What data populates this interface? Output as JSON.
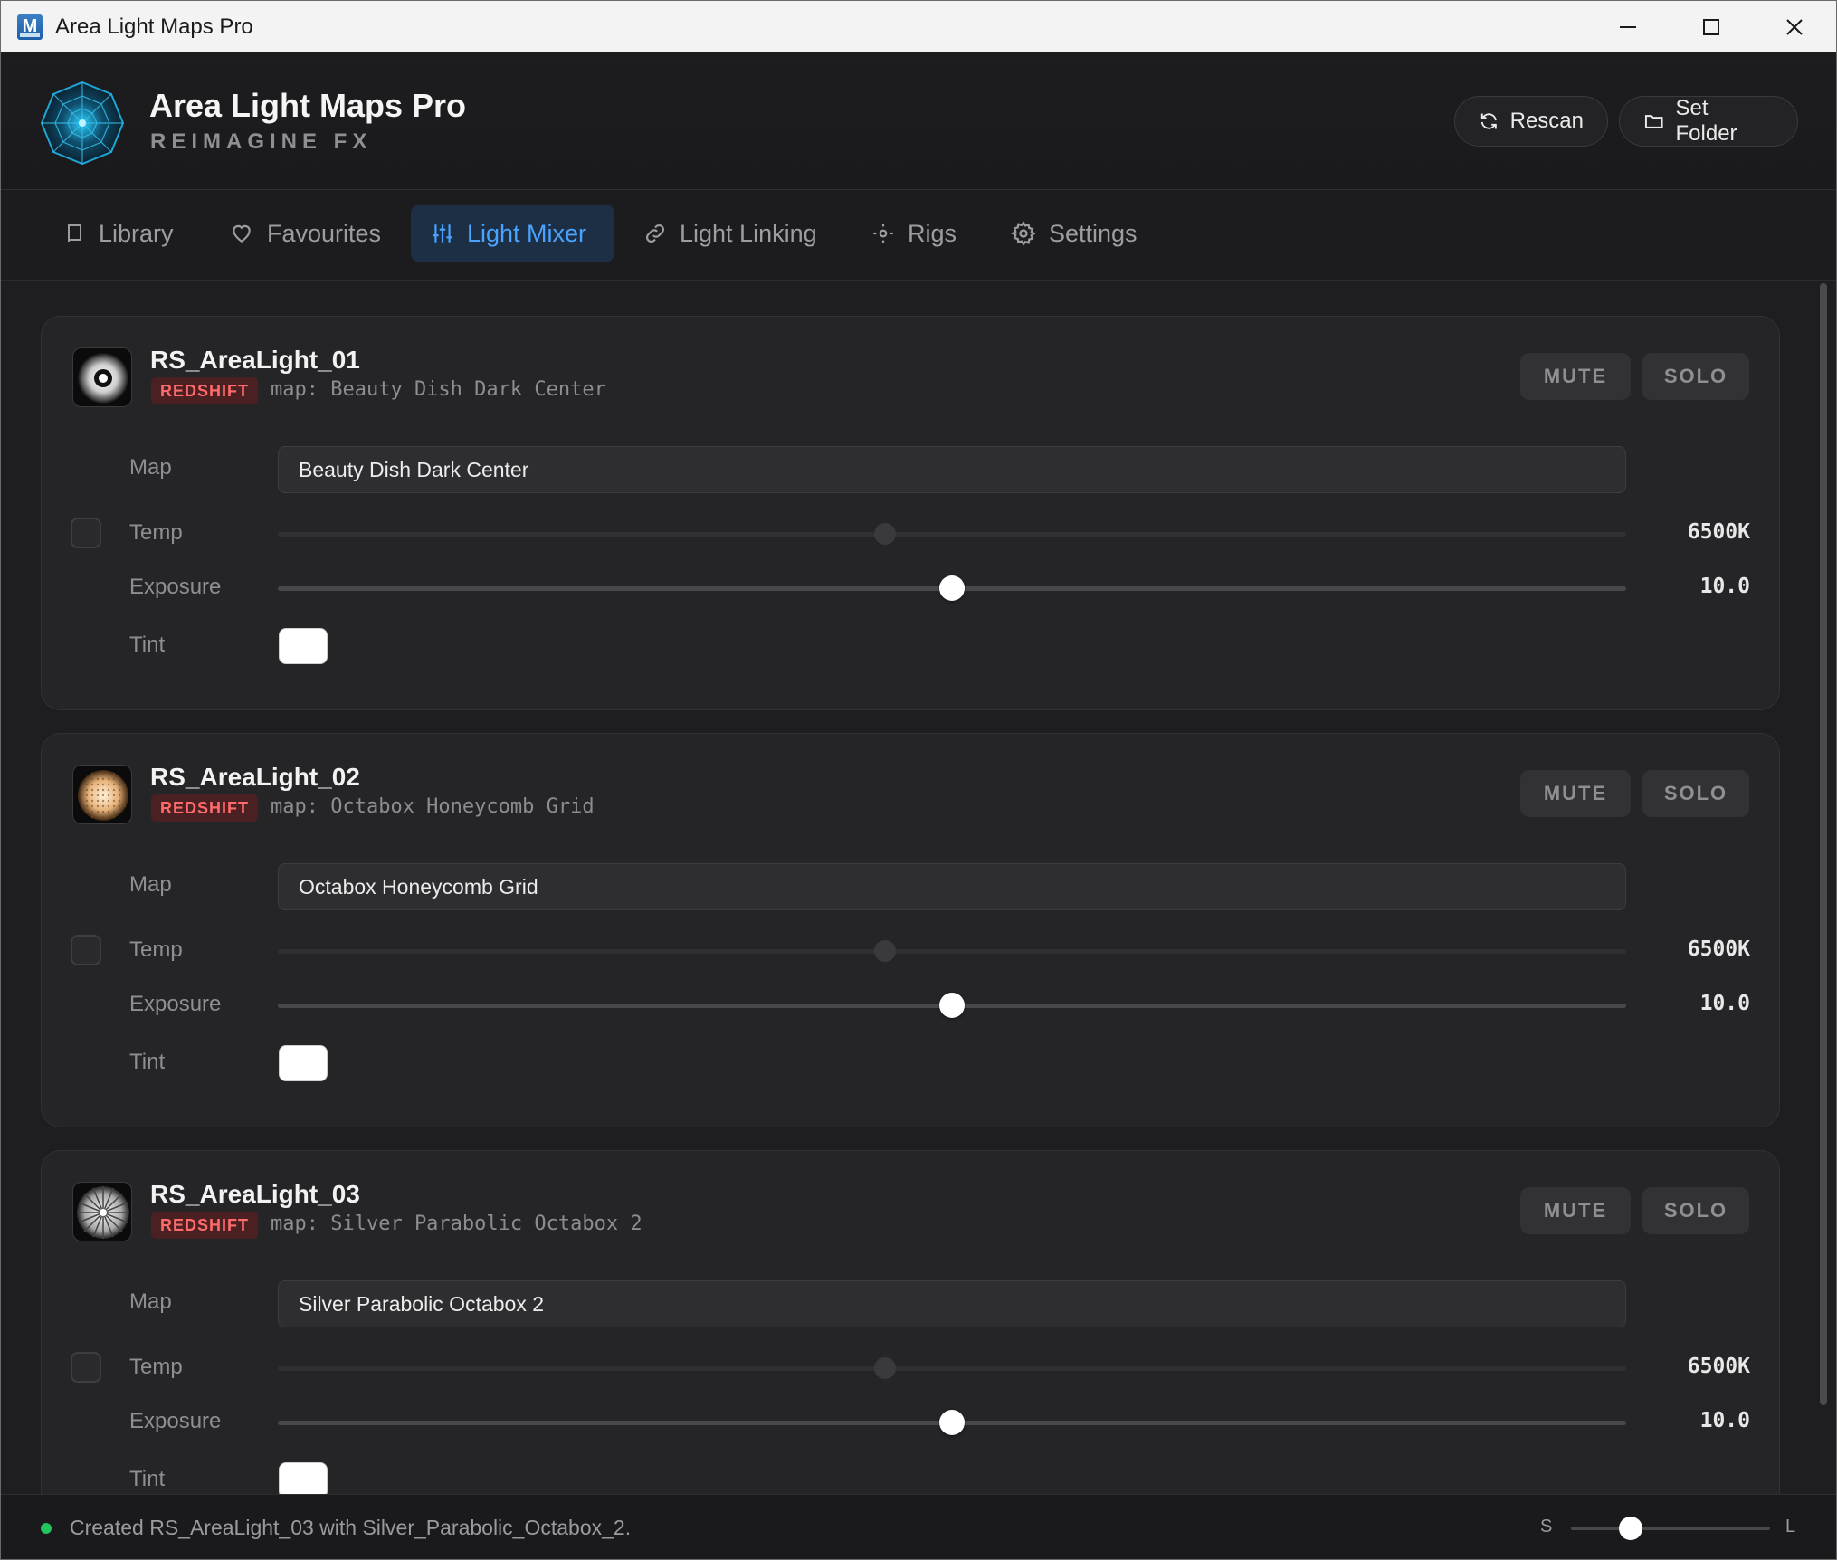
{
  "window": {
    "title": "Area Light Maps Pro",
    "icon_letter": "M"
  },
  "header": {
    "title": "Area Light Maps Pro",
    "subtitle": "REIMAGINE FX",
    "rescan_label": "Rescan",
    "set_folder_label": "Set Folder"
  },
  "tabs": [
    {
      "label": "Library",
      "icon": "book-icon",
      "active": false
    },
    {
      "label": "Favourites",
      "icon": "heart-icon",
      "active": false
    },
    {
      "label": "Light Mixer",
      "icon": "sliders-icon",
      "active": true
    },
    {
      "label": "Light Linking",
      "icon": "link-icon",
      "active": false
    },
    {
      "label": "Rigs",
      "icon": "sun-icon",
      "active": false
    },
    {
      "label": "Settings",
      "icon": "gear-icon",
      "active": false
    }
  ],
  "lights": [
    {
      "name": "RS_AreaLight_01",
      "renderer": "REDSHIFT",
      "map_line": "map: Beauty Dish Dark Center",
      "map": "Beauty Dish Dark Center",
      "mute_label": "MUTE",
      "solo_label": "SOLO",
      "labels": {
        "map": "Map",
        "temp": "Temp",
        "exposure": "Exposure",
        "tint": "Tint"
      },
      "temp_value": "6500K",
      "temp_fraction": 0.45,
      "exposure_value": "10.0",
      "exposure_fraction": 0.5,
      "tint_color": "#ffffff",
      "thumb": "beauty-dish"
    },
    {
      "name": "RS_AreaLight_02",
      "renderer": "REDSHIFT",
      "map_line": "map: Octabox Honeycomb Grid",
      "map": "Octabox Honeycomb Grid",
      "mute_label": "MUTE",
      "solo_label": "SOLO",
      "labels": {
        "map": "Map",
        "temp": "Temp",
        "exposure": "Exposure",
        "tint": "Tint"
      },
      "temp_value": "6500K",
      "temp_fraction": 0.45,
      "exposure_value": "10.0",
      "exposure_fraction": 0.5,
      "tint_color": "#ffffff",
      "thumb": "honeycomb"
    },
    {
      "name": "RS_AreaLight_03",
      "renderer": "REDSHIFT",
      "map_line": "map: Silver Parabolic Octabox 2",
      "map": "Silver Parabolic Octabox 2",
      "mute_label": "MUTE",
      "solo_label": "SOLO",
      "labels": {
        "map": "Map",
        "temp": "Temp",
        "exposure": "Exposure",
        "tint": "Tint"
      },
      "temp_value": "6500K",
      "temp_fraction": 0.45,
      "exposure_value": "10.0",
      "exposure_fraction": 0.5,
      "tint_color": "#ffffff",
      "thumb": "parabolic"
    }
  ],
  "status": {
    "message": "Created RS_AreaLight_03 with Silver_Parabolic_Octabox_2.",
    "size_small": "S",
    "size_large": "L",
    "size_fraction": 0.3
  },
  "colors": {
    "accent": "#4aa3ff",
    "badge": "#ff6b6b",
    "status_ok": "#22c55e"
  }
}
